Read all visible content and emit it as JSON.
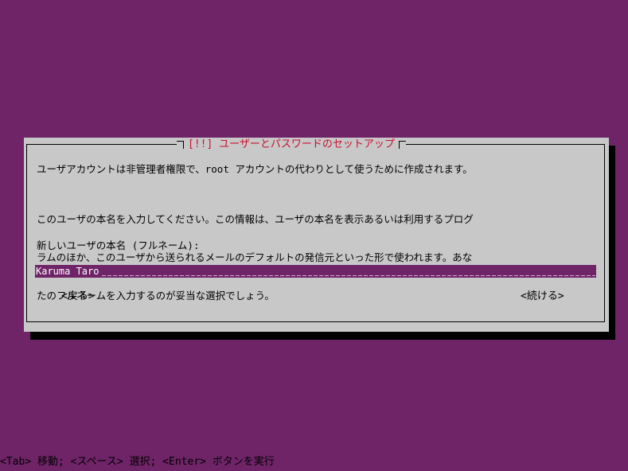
{
  "dialog": {
    "title": "[!!] ユーザーとパスワードのセットアップ",
    "paragraph1": "ユーザアカウントは非管理者権限で、root アカウントの代わりとして使うために作成されます。",
    "paragraph2_lines": [
      "このユーザの本名を入力してください。この情報は、ユーザの本名を表示あるいは利用するプログ",
      "ラムのほか、このユーザから送られるメールのデフォルトの発信元といった形で使われます。あな",
      "たのフルネームを入力するのが妥当な選択でしょう。"
    ],
    "prompt_label": "新しいユーザの本名 (フルネーム):",
    "fullname_input": {
      "value": "Karuma Taro"
    },
    "back_button": "<戻る>",
    "continue_button": "<続ける>"
  },
  "statusbar": {
    "text": "<Tab> 移動; <スペース> 選択; <Enter> ボタンを実行"
  },
  "colors": {
    "background": "#6f2468",
    "dialog": "#c8c8c8",
    "title": "#c8102e",
    "input_bg": "#6f2468",
    "input_text": "#ffffff"
  }
}
